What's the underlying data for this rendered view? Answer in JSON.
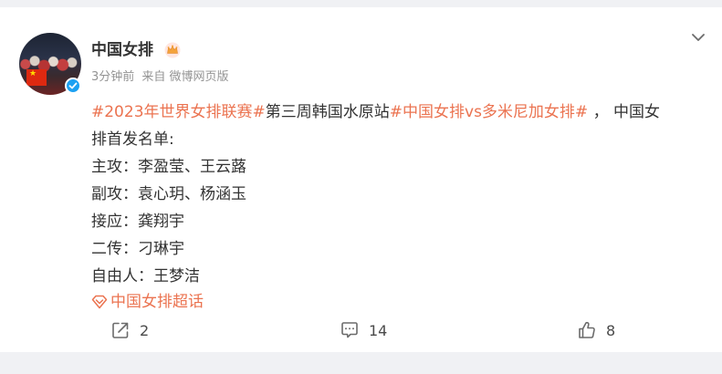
{
  "post": {
    "author": "中国女排",
    "meta": {
      "time": "3分钟前",
      "source": "来自 微博网页版"
    },
    "content": {
      "line1": {
        "tag1": "#2023年世界女排联赛#",
        "text1": "第三周韩国水原站",
        "tag2": "#中国女排vs多米尼加女排#",
        "text2": " ， 中国女"
      },
      "line2": "排首发名单:",
      "lineup": [
        "主攻：李盈莹、王云蕗",
        "副攻：袁心玥、杨涵玉",
        "接应：龚翔宇",
        "二传：刁琳宇",
        "自由人：王梦洁"
      ]
    },
    "supertopic": "中国女排超话"
  },
  "actions": {
    "share_count": "2",
    "comment_count": "14",
    "like_count": "8"
  },
  "icons": {
    "menu": "chevron-down-icon",
    "crown": "crown-icon",
    "verified": "verified-icon",
    "supertopic": "diamond-icon",
    "share": "share-icon",
    "comment": "comment-icon",
    "like": "thumbs-up-icon"
  },
  "colors": {
    "tag": "#eb7350",
    "verified": "#1da1f2",
    "text": "#333333",
    "meta": "#939393"
  }
}
